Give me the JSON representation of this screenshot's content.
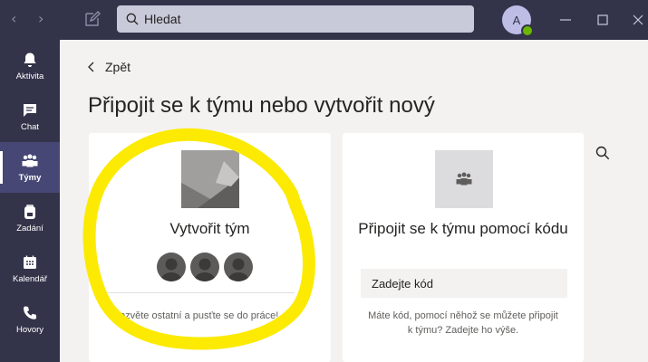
{
  "titlebar": {
    "search": {
      "placeholder": "Hledat"
    },
    "avatar_initial": "A"
  },
  "rail": {
    "items": [
      {
        "label": "Aktivita",
        "icon": "bell-icon"
      },
      {
        "label": "Chat",
        "icon": "chat-icon"
      },
      {
        "label": "Týmy",
        "icon": "teams-icon",
        "active": true
      },
      {
        "label": "Zadání",
        "icon": "backpack-icon"
      },
      {
        "label": "Kalendář",
        "icon": "calendar-icon"
      },
      {
        "label": "Hovory",
        "icon": "phone-icon"
      }
    ]
  },
  "main": {
    "back_label": "Zpět",
    "title": "Připojit se k týmu nebo vytvořit nový",
    "create_card": {
      "title": "Vytvořit tým",
      "description": "Pozvěte ostatní a pusťte se do práce!"
    },
    "join_card": {
      "title": "Připojit se k týmu pomocí kódu",
      "code_placeholder": "Zadejte kód",
      "description": "Máte kód, pomocí něhož se můžete připojit k týmu? Zadejte ho výše."
    }
  },
  "colors": {
    "titlebar": "#33344a",
    "rail_active": "#464775",
    "content_bg": "#f3f2f1",
    "highlight": "#fcea03"
  }
}
